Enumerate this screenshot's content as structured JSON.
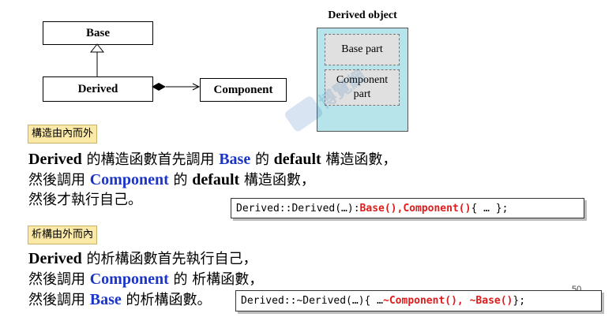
{
  "uml": {
    "base": "Base",
    "derived": "Derived",
    "component": "Component"
  },
  "object_panel": {
    "title": "Derived object",
    "base_part": "Base part",
    "component_part_line1": "Component",
    "component_part_line2": "part"
  },
  "construct": {
    "tag": "構造由內而外",
    "line1_a": "Derived",
    "line1_b": " 的構造函數首先調用 ",
    "line1_c": "Base",
    "line1_d": " 的 ",
    "line1_e": "default",
    "line1_f": " 構造函數，",
    "line2_a": "然後調用 ",
    "line2_b": "Component",
    "line2_c": " 的 ",
    "line2_d": "default",
    "line2_e": " 構造函數，",
    "line3": "然後才執行自己。",
    "code_a": "Derived::Derived(…): ",
    "code_b": "Base(),Component()",
    "code_c": " { … };"
  },
  "destruct": {
    "tag": "析構由外而內",
    "line1_a": "Derived",
    "line1_b": " 的析構函數首先執行自己，",
    "line2_a": "然後調用 ",
    "line2_b": "Component",
    "line2_c": " 的 析構函數，",
    "line3_a": "然後調用 ",
    "line3_b": "Base",
    "line3_c": " 的析構函數。",
    "code_a": "Derived::~Derived(…){ … ",
    "code_b": "~Component(), ~Base()",
    "code_c": " };"
  },
  "page_number": "50",
  "watermark": "博覽網"
}
